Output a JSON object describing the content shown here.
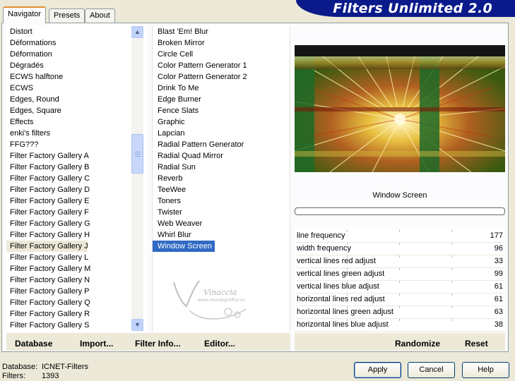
{
  "banner": {
    "title": "Filters Unlimited 2.0"
  },
  "tabs": [
    {
      "label": "Navigator"
    },
    {
      "label": "Presets"
    },
    {
      "label": "About"
    }
  ],
  "categories": [
    "Distort",
    "Déformations",
    "Déformation",
    "Dégradés",
    "ECWS halftone",
    "ECWS",
    "Edges, Round",
    "Edges, Square",
    "Effects",
    "enki's filters",
    "FFG???",
    "Filter Factory Gallery A",
    "Filter Factory Gallery B",
    "Filter Factory Gallery C",
    "Filter Factory Gallery D",
    "Filter Factory Gallery E",
    "Filter Factory Gallery F",
    "Filter Factory Gallery G",
    "Filter Factory Gallery H",
    "Filter Factory Gallery J",
    "Filter Factory Gallery L",
    "Filter Factory Gallery M",
    "Filter Factory Gallery N",
    "Filter Factory Gallery P",
    "Filter Factory Gallery Q",
    "Filter Factory Gallery R",
    "Filter Factory Gallery S"
  ],
  "selected_category": "Filter Factory Gallery J",
  "filters": [
    "Blast 'Em! Blur",
    "Broken Mirror",
    "Circle Cell",
    "Color Pattern Generator 1",
    "Color Pattern Generator 2",
    "Drink To Me",
    "Edge Burner",
    "Fence Slats",
    "Graphic",
    "Lapcian",
    "Radial Pattern Generator",
    "Radial Quad Mirror",
    "Radial Sun",
    "Reverb",
    "TeeWee",
    "Toners",
    "Twister",
    "Web Weaver",
    "Whirl Blur",
    "Window Screen"
  ],
  "selected_filter": "Window Screen",
  "preview": {
    "filter_name": "Window Screen"
  },
  "parameters": [
    {
      "label": "line frequency",
      "value": "177"
    },
    {
      "label": "width frequency",
      "value": "96"
    },
    {
      "label": "vertical lines red adjust",
      "value": "33"
    },
    {
      "label": "vertical lines green adjust",
      "value": "99"
    },
    {
      "label": "vertical lines blue adjust",
      "value": "61"
    },
    {
      "label": "horizontal lines red adjust",
      "value": "61"
    },
    {
      "label": "horizontal lines green adjust",
      "value": "63"
    },
    {
      "label": "horizontal lines blue adjust",
      "value": "38"
    }
  ],
  "toolbar": {
    "database": "Database",
    "import": "Import...",
    "filter_info": "Filter Info...",
    "editor": "Editor...",
    "randomize": "Randomize",
    "reset": "Reset"
  },
  "footer": {
    "database_label": "Database:",
    "database_value": "ICNET-Filters",
    "filters_label": "Filters:",
    "filters_value": "1393"
  },
  "buttons": {
    "apply": "Apply",
    "cancel": "Cancel",
    "help": "Help"
  },
  "watermark": {
    "text": "Vinaccia",
    "subtext": "www.mundografico.ru"
  },
  "colors": {
    "banner": "#0a1a8a",
    "selection": "#316ac5",
    "tab_accent": "#e68b2c"
  }
}
